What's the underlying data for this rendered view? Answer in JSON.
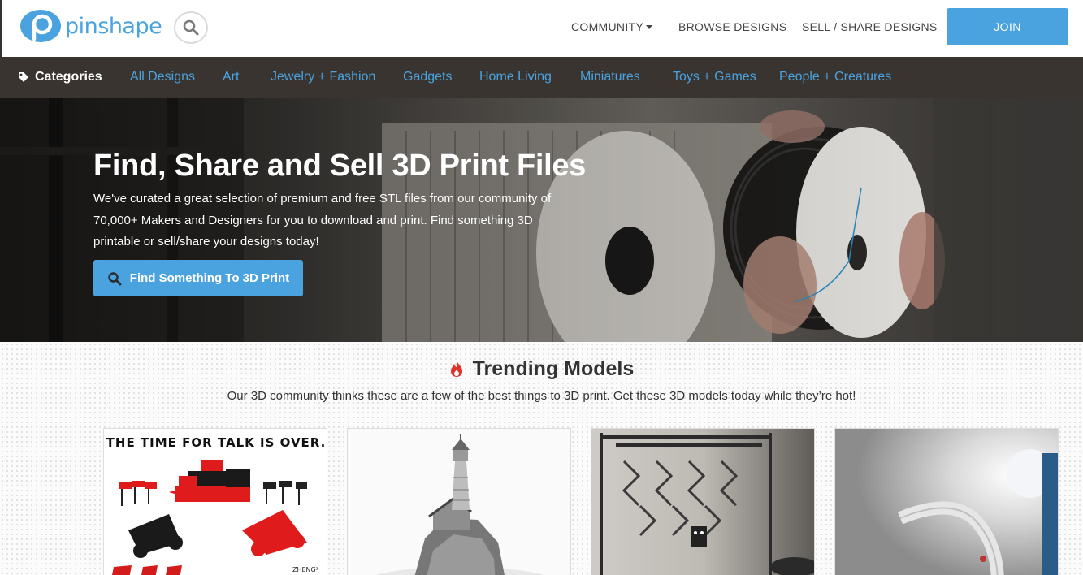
{
  "brand": {
    "name": "pinshape",
    "color": "#4aa3df"
  },
  "header": {
    "search_icon": "search-icon",
    "nav": [
      {
        "label": "COMMUNITY",
        "has_dropdown": true
      },
      {
        "label": "BROWSE DESIGNS"
      },
      {
        "label": "SELL / SHARE DESIGNS"
      }
    ],
    "join_label": "JOIN"
  },
  "categories": {
    "label": "Categories",
    "icon": "tag-icon",
    "items": [
      "All Designs",
      "Art",
      "Jewelry + Fashion",
      "Gadgets",
      "Home Living",
      "Miniatures",
      "Toys + Games",
      "People + Creatures"
    ]
  },
  "hero": {
    "title": "Find, Share and Sell 3D Print Files",
    "subtitle": "We've curated a great selection of premium and free STL files from our community of 70,000+ Makers and Designers for you to download and print. Find something 3D printable or sell/share your designs today!",
    "cta_label": "Find Something To 3D Print",
    "cta_icon": "search-icon"
  },
  "trending": {
    "icon": "fire-icon",
    "title": "Trending Models",
    "subtitle": "Our 3D community thinks these are a few of the best things to 3D print. Get these 3D models today while they’re hot!",
    "cards": [
      {
        "heading": "THE TIME FOR TALK IS OVER.",
        "image": "catapult-game-pieces"
      },
      {
        "image": "lighthouse-model"
      },
      {
        "image": "printer-cube-frame"
      },
      {
        "image": "curved-lamp"
      }
    ]
  }
}
